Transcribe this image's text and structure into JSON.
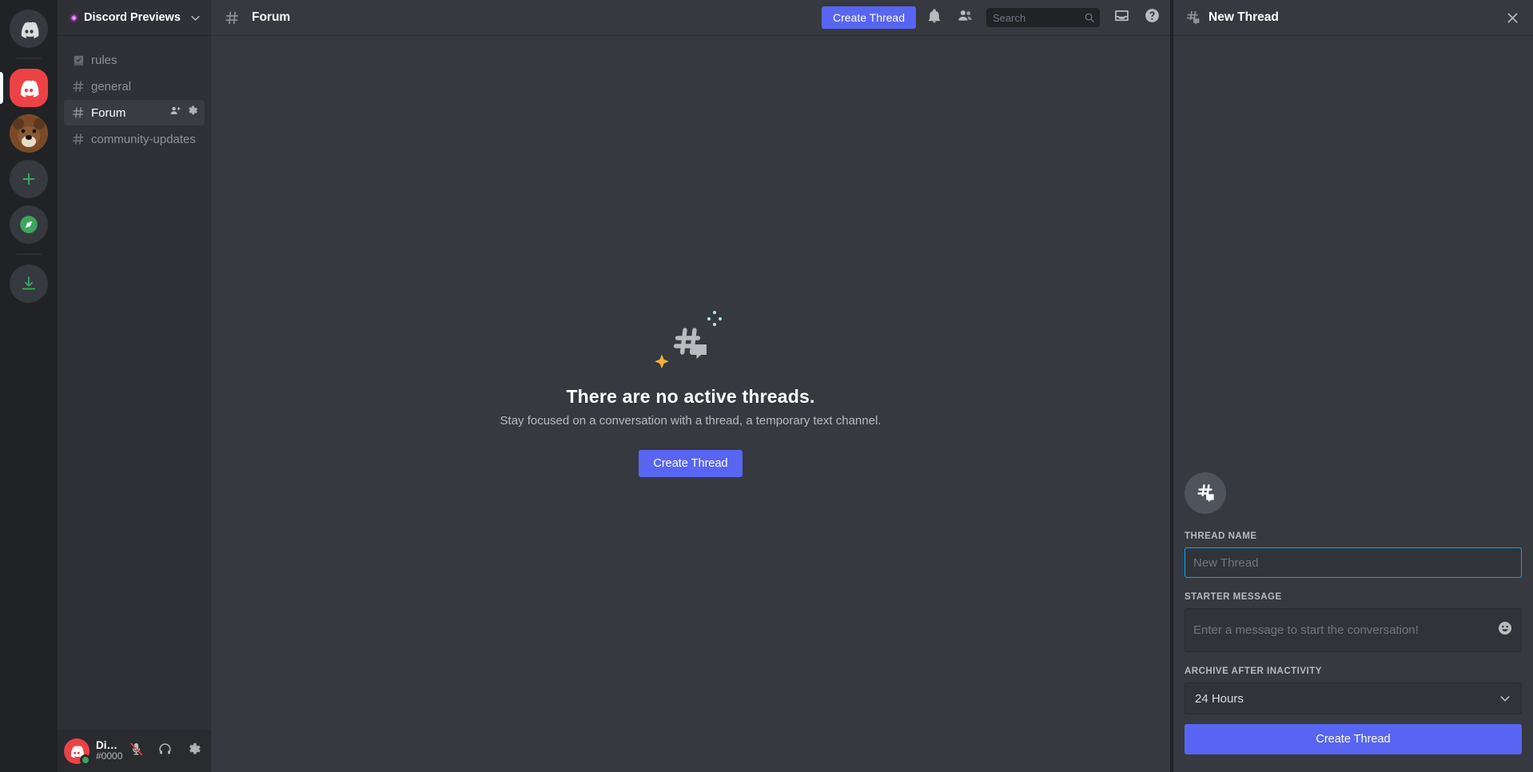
{
  "rail": {
    "items": [
      {
        "name": "direct-messages",
        "icon": "discord-logo",
        "active": false
      },
      {
        "name": "server-discord-previews",
        "icon": "discord-logo",
        "active": true
      },
      {
        "name": "server-bear",
        "icon": "bear-avatar",
        "active": false
      },
      {
        "name": "add-server",
        "icon": "plus-icon",
        "active": false
      },
      {
        "name": "explore-servers",
        "icon": "compass-icon",
        "active": false
      },
      {
        "name": "download-apps",
        "icon": "download-icon",
        "active": false
      }
    ]
  },
  "sidebar": {
    "server_name": "Discord Previews",
    "channels": [
      {
        "label": "rules",
        "icon": "rules-channel-icon",
        "active": false
      },
      {
        "label": "general",
        "icon": "hash-icon",
        "active": false
      },
      {
        "label": "Forum",
        "icon": "hash-icon",
        "active": true
      },
      {
        "label": "community-updates",
        "icon": "hash-icon",
        "active": false
      }
    ],
    "user": {
      "name": "Discord Pre...",
      "tag": "#0000",
      "mic_state": "muted",
      "headset_state": "on"
    }
  },
  "topbar": {
    "channel": "Forum",
    "create_thread_label": "Create Thread",
    "search_placeholder": "Search"
  },
  "empty_state": {
    "title": "There are no active threads.",
    "subtitle": "Stay focused on a conversation with a thread, a temporary text channel.",
    "button_label": "Create Thread"
  },
  "panel": {
    "title": "New Thread",
    "thread_name_label": "THREAD NAME",
    "thread_name_value": "",
    "thread_name_placeholder": "New Thread",
    "starter_message_label": "STARTER MESSAGE",
    "starter_message_placeholder": "Enter a message to start the conversation!",
    "archive_label": "ARCHIVE AFTER INACTIVITY",
    "archive_value": "24 Hours",
    "create_button_label": "Create Thread"
  },
  "colors": {
    "brand": "#5865f2",
    "focus": "#00a8fc",
    "online": "#3ba55d",
    "danger": "#ed4245"
  }
}
